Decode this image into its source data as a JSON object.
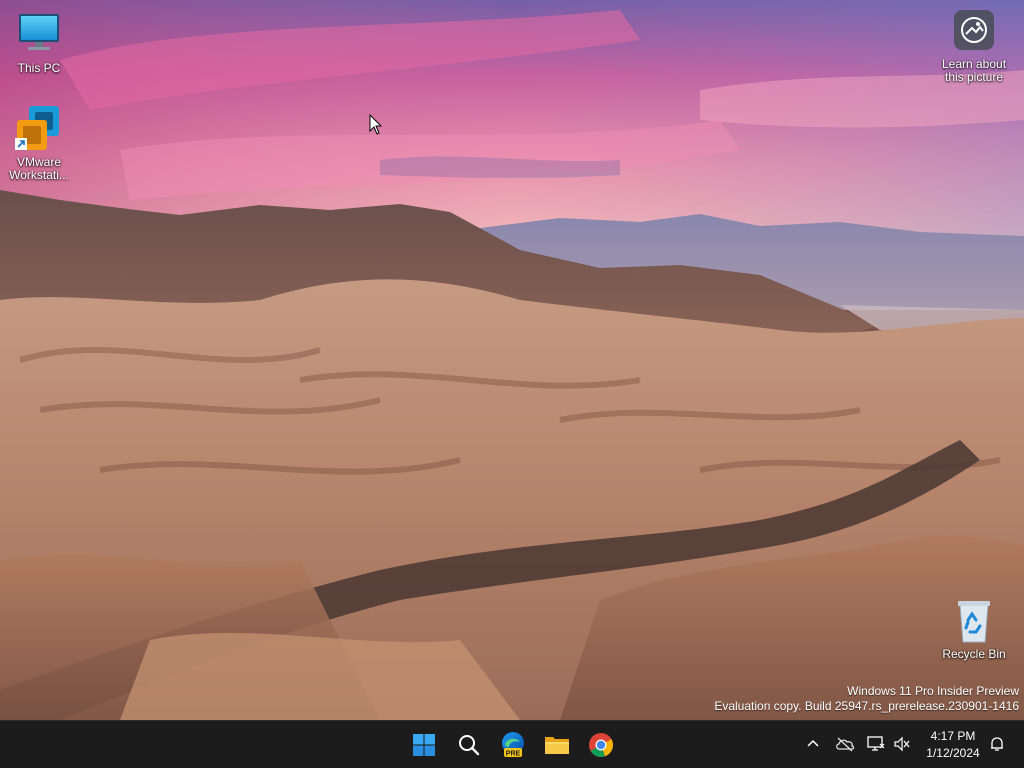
{
  "desktop": {
    "icons": [
      {
        "label": "This PC",
        "icon": "this-pc-icon"
      },
      {
        "label": "VMware Workstati...",
        "icon": "vmware-workstation-icon"
      },
      {
        "label": "Learn about this picture",
        "icon": "learn-about-picture-icon"
      },
      {
        "label": "Recycle Bin",
        "icon": "recycle-bin-icon"
      }
    ],
    "watermark": {
      "line1": "Windows 11 Pro Insider Preview",
      "line2": "Evaluation copy. Build 25947.rs_prerelease.230901-1416"
    }
  },
  "taskbar": {
    "apps": [
      {
        "name": "Start",
        "icon": "windows-start-icon"
      },
      {
        "name": "Search",
        "icon": "search-icon"
      },
      {
        "name": "Microsoft Edge Dev",
        "icon": "edge-pre-icon",
        "badge": "PRE"
      },
      {
        "name": "File Explorer",
        "icon": "file-explorer-icon"
      },
      {
        "name": "Google Chrome",
        "icon": "chrome-icon"
      }
    ],
    "tray": {
      "icons": [
        "chevron-up-icon",
        "onedrive-offline-icon",
        "network-icon",
        "volume-muted-icon",
        "notification-bell-icon"
      ]
    },
    "clock": {
      "time": "4:17 PM",
      "date": "1/12/2024"
    }
  },
  "colors": {
    "taskbar_bg": "#1c1c1c",
    "windows_blue": "#0078d4"
  }
}
